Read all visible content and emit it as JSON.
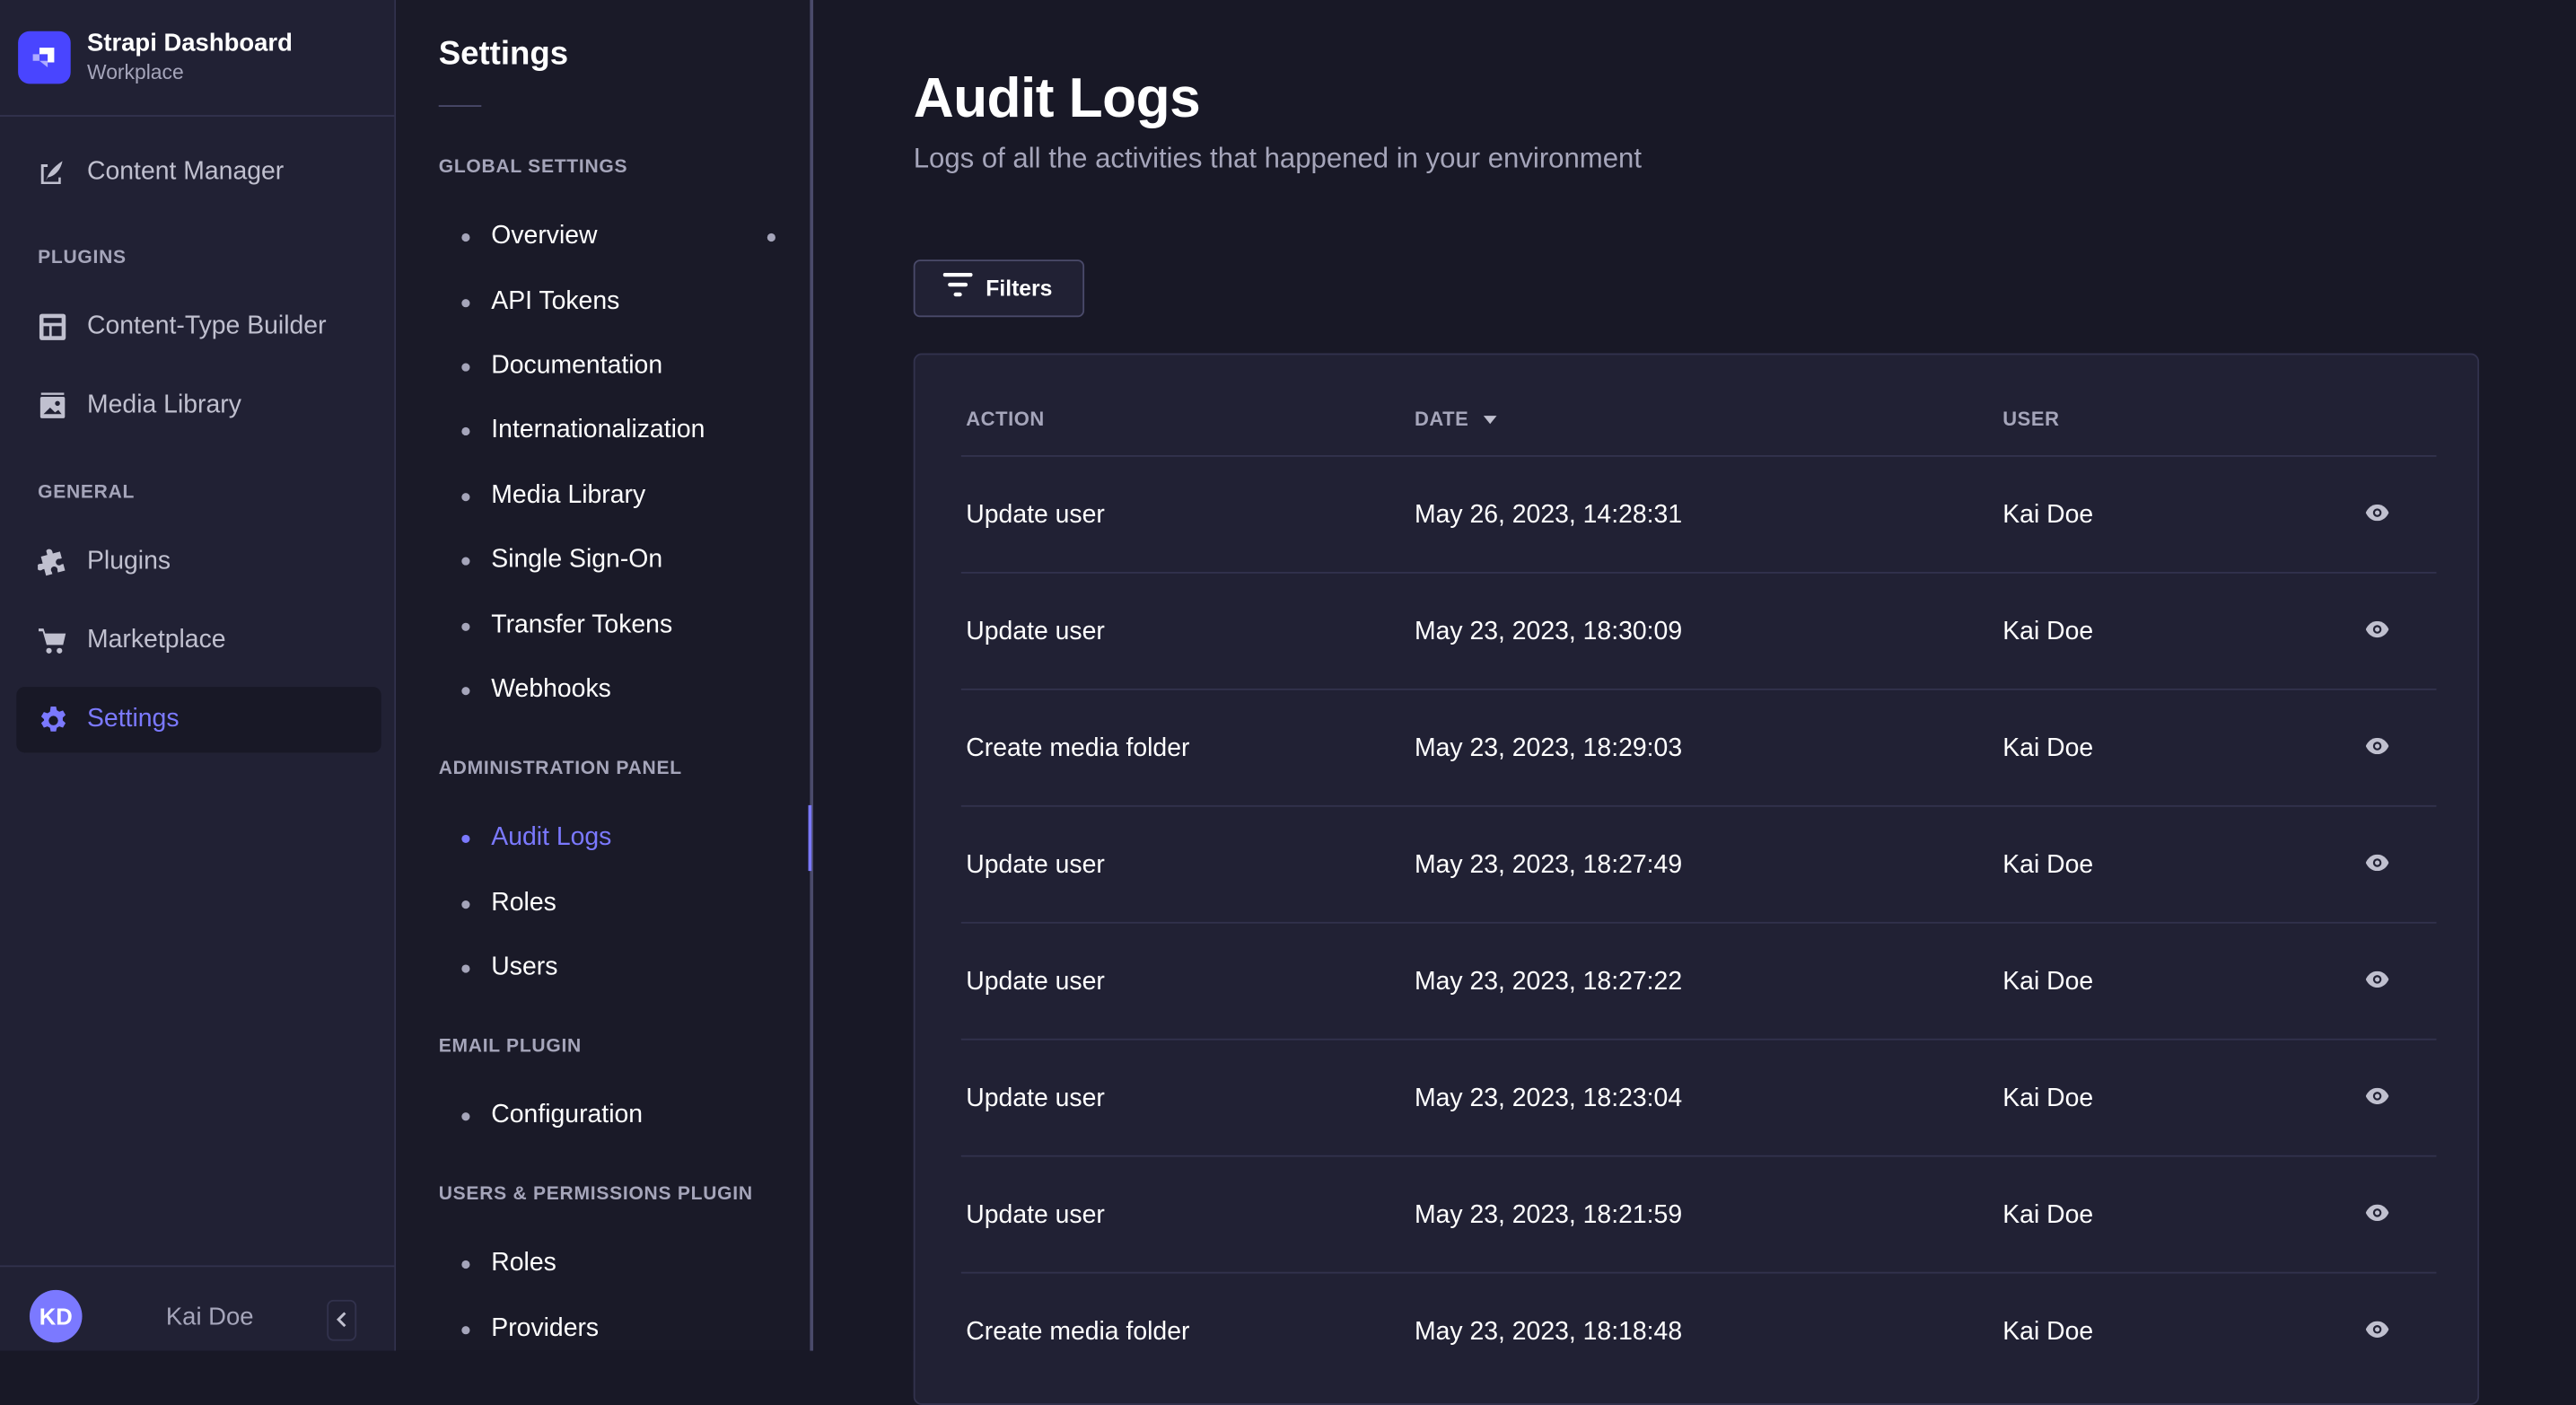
{
  "brand": {
    "title": "Strapi Dashboard",
    "subtitle": "Workplace",
    "color": "#4945ff"
  },
  "mainnav": {
    "content_manager": "Content Manager",
    "sections": {
      "plugins": "PLUGINS",
      "general": "GENERAL"
    },
    "plugins": [
      {
        "label": "Content-Type Builder",
        "icon": "layout-icon"
      },
      {
        "label": "Media Library",
        "icon": "image-icon"
      }
    ],
    "general": [
      {
        "label": "Plugins",
        "icon": "puzzle-icon"
      },
      {
        "label": "Marketplace",
        "icon": "cart-icon"
      },
      {
        "label": "Settings",
        "icon": "gear-icon",
        "active": true
      }
    ],
    "footer": {
      "initials": "KD",
      "name": "Kai Doe"
    }
  },
  "subnav": {
    "title": "Settings",
    "sections": [
      {
        "title": "GLOBAL SETTINGS",
        "items": [
          "Overview",
          "API Tokens",
          "Documentation",
          "Internationalization",
          "Media Library",
          "Single Sign-On",
          "Transfer Tokens",
          "Webhooks"
        ]
      },
      {
        "title": "ADMINISTRATION PANEL",
        "items": [
          "Audit Logs",
          "Roles",
          "Users"
        ]
      },
      {
        "title": "EMAIL PLUGIN",
        "items": [
          "Configuration"
        ]
      },
      {
        "title": "USERS & PERMISSIONS PLUGIN",
        "items": [
          "Roles",
          "Providers"
        ]
      }
    ],
    "active_item": "Audit Logs"
  },
  "main": {
    "title": "Audit Logs",
    "subtitle": "Logs of all the activities that happened in your environment",
    "filters_label": "Filters",
    "columns": [
      "ACTION",
      "DATE",
      "USER"
    ],
    "sorted_column": "DATE",
    "rows": [
      {
        "action": "Update user",
        "date": "May 26, 2023, 14:28:31",
        "user": "Kai Doe"
      },
      {
        "action": "Update user",
        "date": "May 23, 2023, 18:30:09",
        "user": "Kai Doe"
      },
      {
        "action": "Create media folder",
        "date": "May 23, 2023, 18:29:03",
        "user": "Kai Doe"
      },
      {
        "action": "Update user",
        "date": "May 23, 2023, 18:27:49",
        "user": "Kai Doe"
      },
      {
        "action": "Update user",
        "date": "May 23, 2023, 18:27:22",
        "user": "Kai Doe"
      },
      {
        "action": "Update user",
        "date": "May 23, 2023, 18:23:04",
        "user": "Kai Doe"
      },
      {
        "action": "Update user",
        "date": "May 23, 2023, 18:21:59",
        "user": "Kai Doe"
      },
      {
        "action": "Create media folder",
        "date": "May 23, 2023, 18:18:48",
        "user": "Kai Doe"
      }
    ]
  },
  "colors": {
    "accent": "#7b79ff",
    "background": "#181826",
    "panel": "#212134",
    "muted_text": "#a5a5ba"
  }
}
